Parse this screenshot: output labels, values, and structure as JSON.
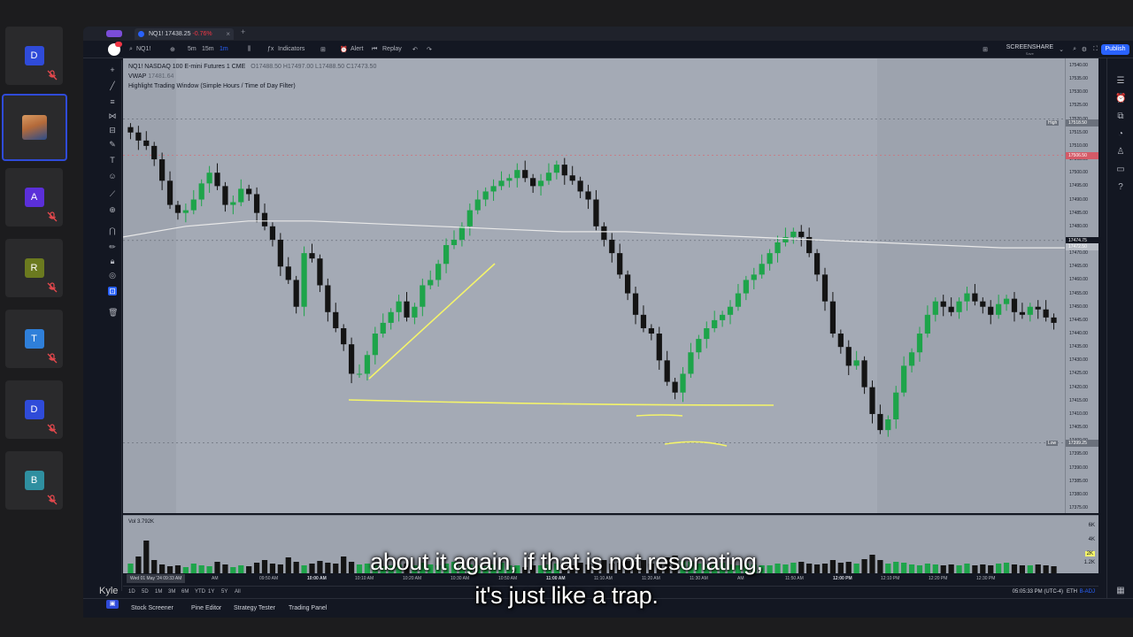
{
  "participants": [
    {
      "initial": "D",
      "color": "#2f4bd9",
      "muted": true
    },
    {
      "initial": "",
      "color": "",
      "muted": false,
      "is_video": true
    },
    {
      "initial": "A",
      "color": "#5b2fd9",
      "muted": true
    },
    {
      "initial": "R",
      "color": "#6b7a1f",
      "muted": true
    },
    {
      "initial": "T",
      "color": "#2f7fd9",
      "muted": true
    },
    {
      "initial": "D",
      "color": "#2f4bd9",
      "muted": true
    },
    {
      "initial": "B",
      "color": "#2f8fa0",
      "muted": true
    }
  ],
  "self": {
    "name": "Kyle",
    "badge": "Kyle"
  },
  "browser": {
    "tab_title": "NQ1! 17438.25",
    "tab_change": "-0.76%",
    "new_tab": "+",
    "close": "×"
  },
  "toolbar": {
    "symbol": "NQ1!",
    "add": "⊕",
    "tf_5m": "5m",
    "tf_15m": "15m",
    "tf_1m": "1m",
    "chart_type": "⫼",
    "indicators": "Indicators",
    "layout": "⊞",
    "alert": "Alert",
    "replay": "Replay",
    "undo": "↶",
    "redo": "↷",
    "screenshare": "SCREENSHARE",
    "screenshare_sub": "Save",
    "publish": "Publish"
  },
  "legend": {
    "title": "NQ1!  NASDAQ 100 E-mini Futures  1  CME",
    "ohlc": "O17488.50 H17497.00 L17488.50 C17473.50",
    "vwap_label": "VWAP",
    "vwap_value": "17481.64",
    "indicator": "Highlight Trading Window (Simple Hours / Time of Day Filter)"
  },
  "price_axis": {
    "labels": [
      "17540.00",
      "17535.00",
      "17530.00",
      "17525.00",
      "17520.00",
      "17515.00",
      "17510.00",
      "17505.00",
      "17500.00",
      "17495.00",
      "17490.00",
      "17485.00",
      "17480.00",
      "17475.00",
      "17470.00",
      "17465.00",
      "17460.00",
      "17455.00",
      "17450.00",
      "17445.00",
      "17440.00",
      "17435.00",
      "17430.00",
      "17425.00",
      "17420.00",
      "17415.00",
      "17410.00",
      "17405.00",
      "17400.00",
      "17395.00",
      "17390.00",
      "17385.00",
      "17380.00",
      "17375.00"
    ],
    "high_label": "High",
    "high_value": "17518.50",
    "alert_value": "17506.50",
    "last_value": "17474.75",
    "vwap_value": "17472.50",
    "low_label": "Low",
    "low_value": "17399.25"
  },
  "volume": {
    "label": "Vol",
    "value": "3.792K",
    "axis": [
      "6K",
      "4K",
      "2K"
    ],
    "tag": "2K",
    "tag2": "1.2K"
  },
  "time_axis": {
    "cursor": "Wed 01 May '24   09:33 AM",
    "labels": [
      {
        "t": "AM",
        "bold": false
      },
      {
        "t": "09:50 AM",
        "bold": false
      },
      {
        "t": "10:00 AM",
        "bold": true
      },
      {
        "t": "10:10 AM",
        "bold": false
      },
      {
        "t": "10:20 AM",
        "bold": false
      },
      {
        "t": "10:30 AM",
        "bold": false
      },
      {
        "t": "10:50 AM",
        "bold": false
      },
      {
        "t": "11:00 AM",
        "bold": true
      },
      {
        "t": "11:10 AM",
        "bold": false
      },
      {
        "t": "11:20 AM",
        "bold": false
      },
      {
        "t": "11:30 AM",
        "bold": false
      },
      {
        "t": "AM",
        "bold": false
      },
      {
        "t": "11:50 AM",
        "bold": false
      },
      {
        "t": "12:00 PM",
        "bold": true
      },
      {
        "t": "12:10 PM",
        "bold": false
      },
      {
        "t": "12:20 PM",
        "bold": false
      },
      {
        "t": "12:30 PM",
        "bold": false
      }
    ]
  },
  "bottom_bar": {
    "ranges": [
      "1D",
      "5D",
      "1M",
      "3M",
      "6M",
      "YTD",
      "1Y",
      "5Y",
      "All"
    ],
    "clock": "05:05:33 PM (UTC-4)",
    "session": "ETH",
    "adj": "B-ADJ"
  },
  "footer_tabs": [
    "Stock Screener",
    "Pine Editor",
    "Strategy Tester",
    "Trading Panel"
  ],
  "caption": {
    "line1": "about it again, if that is not resonating,",
    "line2": "it's just like a trap."
  },
  "colors": {
    "up": "#1ea44a",
    "down": "#141414",
    "vwap": "#e8e8e8",
    "annotation": "#f4f46a",
    "accent": "#2962ff",
    "alert": "#f23645"
  },
  "chart_data": {
    "type": "candlestick",
    "symbol": "NQ1!",
    "title": "NQ1!  NASDAQ 100 E-mini Futures  1  CME",
    "ylim": [
      17375,
      17540
    ],
    "vwap": [
      17476,
      17480,
      17482,
      17482,
      17481,
      17480,
      17479,
      17478,
      17478,
      17477,
      17476,
      17475,
      17474,
      17473,
      17472,
      17472
    ],
    "close_path": [
      17515,
      17512,
      17510,
      17505,
      17497,
      17488,
      17485,
      17486,
      17490,
      17496,
      17500,
      17495,
      17488,
      17489,
      17494,
      17492,
      17485,
      17480,
      17475,
      17465,
      17460,
      17450,
      17470,
      17468,
      17458,
      17448,
      17442,
      17436,
      17425,
      17425,
      17432,
      17440,
      17444,
      17448,
      17452,
      17446,
      17450,
      17458,
      17460,
      17466,
      17473,
      17475,
      17480,
      17486,
      17490,
      17493,
      17495,
      17497,
      17498,
      17501,
      17498,
      17495,
      17497,
      17500,
      17503,
      17499,
      17497,
      17493,
      17490,
      17480,
      17475,
      17470,
      17462,
      17455,
      17447,
      17442,
      17440,
      17430,
      17422,
      17418,
      17425,
      17433,
      17438,
      17442,
      17445,
      17447,
      17450,
      17455,
      17460,
      17462,
      17466,
      17470,
      17474,
      17476,
      17478,
      17476,
      17470,
      17462,
      17452,
      17440,
      17435,
      17428,
      17430,
      17420,
      17410,
      17404,
      17408,
      17418,
      17428,
      17433,
      17440,
      17447,
      17452,
      17450,
      17448,
      17452,
      17455,
      17452,
      17450,
      17447,
      17451,
      17453,
      17448,
      17447,
      17450,
      17449,
      17446,
      17444
    ],
    "volume": [
      1.2,
      2.0,
      3.8,
      1.6,
      1.1,
      0.9,
      1.0,
      0.8,
      1.2,
      1.0,
      0.9,
      1.4,
      1.1,
      0.8,
      1.0,
      0.9,
      1.3,
      1.6,
      1.2,
      1.1,
      1.9,
      1.4,
      1.0,
      1.2,
      1.5,
      1.3,
      1.2,
      2.0,
      1.4,
      1.1,
      1.2,
      1.0,
      0.9,
      1.0,
      1.1,
      1.2,
      1.0,
      1.3,
      1.1,
      1.0,
      1.2,
      1.4,
      1.2,
      1.1,
      1.0,
      0.9,
      1.1,
      1.3,
      1.0,
      1.0,
      0.8,
      1.0,
      1.0,
      1.1,
      1.2,
      0.9,
      1.0,
      1.3,
      1.1,
      1.4,
      1.6,
      1.2,
      1.3,
      1.5,
      1.4,
      1.6,
      1.2,
      1.3,
      1.9,
      2.1,
      1.5,
      1.4,
      1.2,
      1.1,
      1.2,
      1.3,
      1.1,
      1.0,
      1.2,
      1.1,
      1.0,
      1.0,
      1.2,
      1.1,
      1.3,
      1.4,
      1.2,
      1.1,
      1.2,
      1.6,
      1.3,
      1.4,
      1.2,
      1.7,
      2.2,
      1.6,
      1.2,
      1.4,
      1.3,
      1.1,
      1.0,
      1.2,
      1.1,
      1.0,
      1.1,
      1.0,
      1.2,
      1.0,
      1.1,
      1.0,
      1.2,
      1.3,
      1.1,
      1.0,
      1.0,
      1.1,
      1.0,
      0.9
    ]
  }
}
